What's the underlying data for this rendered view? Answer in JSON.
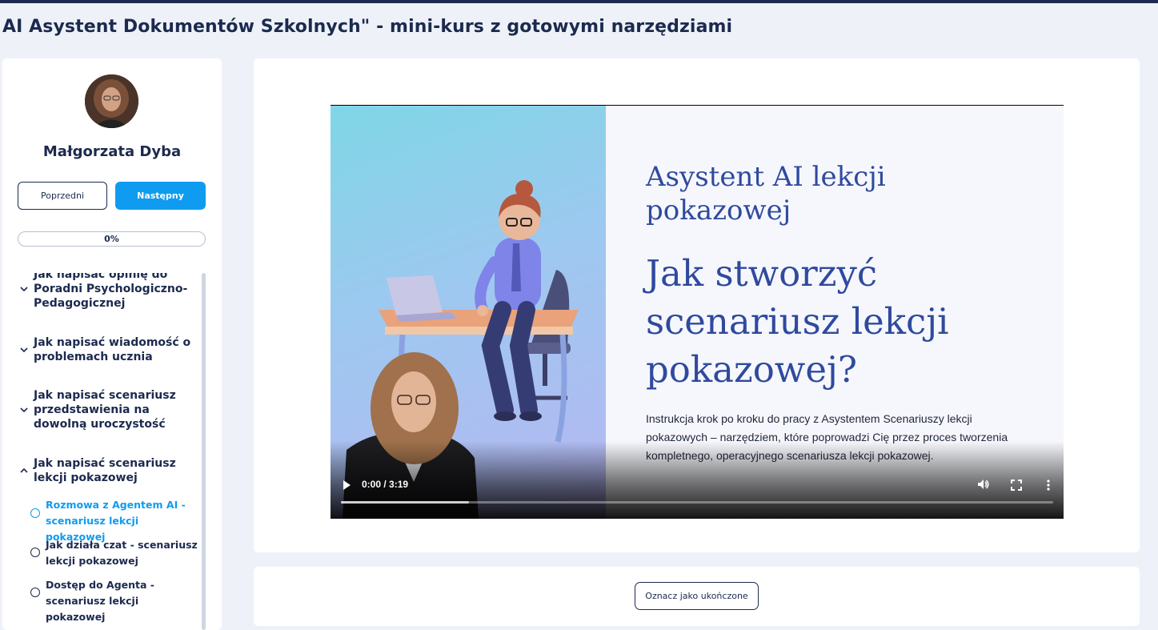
{
  "page": {
    "title": "AI Asystent Dokumentów Szkolnych\" - mini-kurs z gotowymi narzędziami"
  },
  "sidebar": {
    "author_name": "Małgorzata Dyba",
    "prev_label": "Poprzedni",
    "next_label": "Następny",
    "progress": {
      "label": "0%",
      "value_percent": 0
    },
    "sections": [
      {
        "title": "Jak napisać opinię do Poradni Psychologiczno-Pedagogicznej",
        "expanded": false,
        "chevron": "chevron-down-icon"
      },
      {
        "title": "Jak napisać wiadomość o problemach ucznia",
        "expanded": false,
        "chevron": "chevron-down-icon"
      },
      {
        "title": "Jak napisać scenariusz przedstawienia na dowolną uroczystość",
        "expanded": false,
        "chevron": "chevron-down-icon"
      },
      {
        "title": "Jak napisać scenariusz lekcji pokazowej",
        "expanded": true,
        "chevron": "chevron-up-icon"
      }
    ],
    "lessons": [
      {
        "title": "Rozmowa z Agentem AI - scenariusz lekcji pokazowej",
        "active": true
      },
      {
        "title": "Jak działa czat - scenariusz lekcji pokazowej",
        "active": false
      },
      {
        "title": "Dostęp do Agenta - scenariusz lekcji pokazowej",
        "active": false
      }
    ]
  },
  "video": {
    "heading_small": "Asystent AI lekcji pokazowej",
    "heading_large": "Jak stworzyć scenariusz lekcji pokazowej?",
    "description": "Instrukcja krok po kroku do pracy z Asystentem Scenariuszy lekcji pokazowych – narzędziem, które poprowadzi Cię przez proces tworzenia kompletnego, operacyjnego scenariusza lekcji pokazowej.",
    "time": "0:00 / 3:19",
    "buffered_fraction": 0.18
  },
  "complete_label": "Oznacz jako ukończone",
  "colors": {
    "navy": "#1c2a4f",
    "accent": "#0f9cf0",
    "video_heading": "#2f4a9e",
    "background": "#eef2f8"
  }
}
